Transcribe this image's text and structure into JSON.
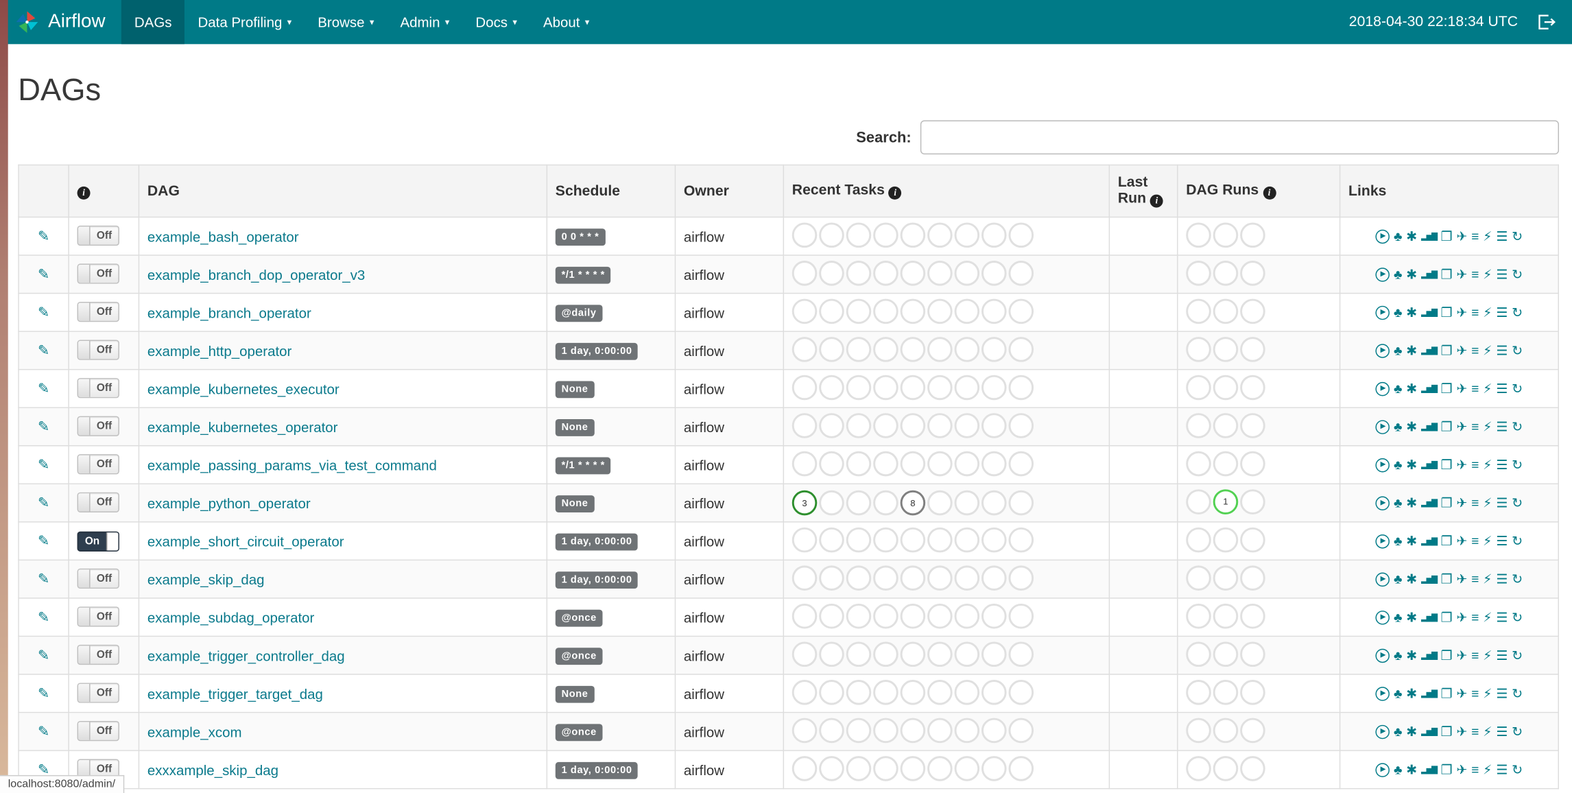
{
  "colors": {
    "accent": "#007A87",
    "nav_active": "#00616d",
    "link": "#0b7a8c",
    "badge_bg": "#6f7376",
    "toggle_on": "#2e3e4e",
    "circle_border": "#e0e0e0",
    "header_bg": "#f4f4f4"
  },
  "navbar": {
    "brand": "Airflow",
    "clock": "2018-04-30 22:18:34 UTC",
    "items": [
      {
        "label": "DAGs",
        "active": true,
        "dropdown": false
      },
      {
        "label": "Data Profiling",
        "active": false,
        "dropdown": true
      },
      {
        "label": "Browse",
        "active": false,
        "dropdown": true
      },
      {
        "label": "Admin",
        "active": false,
        "dropdown": true
      },
      {
        "label": "Docs",
        "active": false,
        "dropdown": true
      },
      {
        "label": "About",
        "active": false,
        "dropdown": true
      }
    ]
  },
  "page": {
    "title": "DAGs",
    "search_label": "Search:",
    "status_bar": "localhost:8080/admin/"
  },
  "table": {
    "headers": {
      "dag": "DAG",
      "schedule": "Schedule",
      "owner": "Owner",
      "recent": "Recent Tasks",
      "last_run": "Last Run",
      "dag_runs": "DAG Runs",
      "links": "Links"
    },
    "toggle_on_label": "On",
    "toggle_off_label": "Off",
    "recent_slots": 9,
    "dagrun_slots": 3,
    "link_icons": [
      {
        "name": "trigger-dag-icon",
        "glyph": "▶",
        "circled": true
      },
      {
        "name": "tree-view-icon",
        "glyph": "♣"
      },
      {
        "name": "graph-view-icon",
        "glyph": "✱"
      },
      {
        "name": "task-duration-icon",
        "glyph": "▂▅▇",
        "size": "8px",
        "tight": true
      },
      {
        "name": "task-tries-icon",
        "glyph": "❐"
      },
      {
        "name": "landing-times-icon",
        "glyph": "✈"
      },
      {
        "name": "gantt-view-icon",
        "glyph": "≡"
      },
      {
        "name": "code-view-icon",
        "glyph": "⚡"
      },
      {
        "name": "log-icon",
        "glyph": "☰"
      },
      {
        "name": "refresh-icon",
        "glyph": "↻"
      }
    ],
    "rows": [
      {
        "dag": "example_bash_operator",
        "state": "off",
        "schedule": "0 0 * * *",
        "owner": "airflow",
        "recent": [],
        "dag_runs": []
      },
      {
        "dag": "example_branch_dop_operator_v3",
        "state": "off",
        "schedule": "*/1 * * * *",
        "owner": "airflow",
        "recent": [],
        "dag_runs": []
      },
      {
        "dag": "example_branch_operator",
        "state": "off",
        "schedule": "@daily",
        "owner": "airflow",
        "recent": [],
        "dag_runs": []
      },
      {
        "dag": "example_http_operator",
        "state": "off",
        "schedule": "1 day, 0:00:00",
        "owner": "airflow",
        "recent": [],
        "dag_runs": []
      },
      {
        "dag": "example_kubernetes_executor",
        "state": "off",
        "schedule": "None",
        "owner": "airflow",
        "recent": [],
        "dag_runs": []
      },
      {
        "dag": "example_kubernetes_operator",
        "state": "off",
        "schedule": "None",
        "owner": "airflow",
        "recent": [],
        "dag_runs": []
      },
      {
        "dag": "example_passing_params_via_test_command",
        "state": "off",
        "schedule": "*/1 * * * *",
        "owner": "airflow",
        "recent": [],
        "dag_runs": []
      },
      {
        "dag": "example_python_operator",
        "state": "off",
        "schedule": "None",
        "owner": "airflow",
        "recent": [
          {
            "slot": 0,
            "count": "3",
            "color": "#2e8f2e"
          },
          {
            "slot": 4,
            "count": "8",
            "color": "#808080"
          }
        ],
        "dag_runs": [
          {
            "slot": 1,
            "count": "1",
            "color": "#52d152"
          }
        ]
      },
      {
        "dag": "example_short_circuit_operator",
        "state": "on",
        "schedule": "1 day, 0:00:00",
        "owner": "airflow",
        "recent": [],
        "dag_runs": []
      },
      {
        "dag": "example_skip_dag",
        "state": "off",
        "schedule": "1 day, 0:00:00",
        "owner": "airflow",
        "recent": [],
        "dag_runs": []
      },
      {
        "dag": "example_subdag_operator",
        "state": "off",
        "schedule": "@once",
        "owner": "airflow",
        "recent": [],
        "dag_runs": []
      },
      {
        "dag": "example_trigger_controller_dag",
        "state": "off",
        "schedule": "@once",
        "owner": "airflow",
        "recent": [],
        "dag_runs": []
      },
      {
        "dag": "example_trigger_target_dag",
        "state": "off",
        "schedule": "None",
        "owner": "airflow",
        "recent": [],
        "dag_runs": []
      },
      {
        "dag": "example_xcom",
        "state": "off",
        "schedule": "@once",
        "owner": "airflow",
        "recent": [],
        "dag_runs": []
      },
      {
        "dag": "exxxample_skip_dag",
        "state": "off",
        "schedule": "1 day, 0:00:00",
        "owner": "airflow",
        "recent": [],
        "dag_runs": []
      }
    ]
  }
}
